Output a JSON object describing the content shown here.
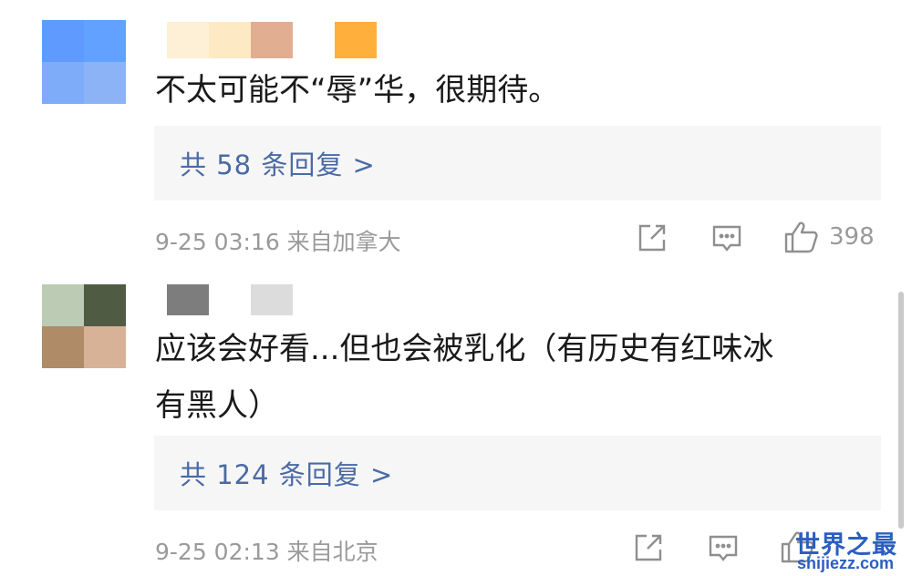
{
  "comments": [
    {
      "avatar_colors": [
        "#5f9bff",
        "#62a1ff",
        "#7eacf8",
        "#8cb3f6"
      ],
      "name_colors": [
        "#fdf0d6",
        "#fde9c4",
        "#e2ae92",
        "#ffffff",
        "#ffb03c"
      ],
      "text": "不太可能不“辱”华，很期待。",
      "reply_link": "共 58 条回复 >",
      "meta": "9-25 03:16  来自加拿大",
      "likes": "398"
    },
    {
      "avatar_colors": [
        "#bccbb3",
        "#4f5c43",
        "#b08b67",
        "#d8b296"
      ],
      "name_colors": [
        "#7d7d7d",
        "#ffffff",
        "#dcdcdc"
      ],
      "text_line1": "应该会好看...但也会被乳化（有历史有红味冰",
      "text_line2": "有黑人）",
      "reply_link": "共 124 条回复 >",
      "meta": "9-25 02:13  来自北京",
      "likes": ""
    }
  ],
  "watermark": {
    "title": "世界之最",
    "domain": "shijiezz.com"
  },
  "icons": {
    "share": "share-icon",
    "comment": "comment-icon",
    "like": "thumbs-up-icon"
  }
}
